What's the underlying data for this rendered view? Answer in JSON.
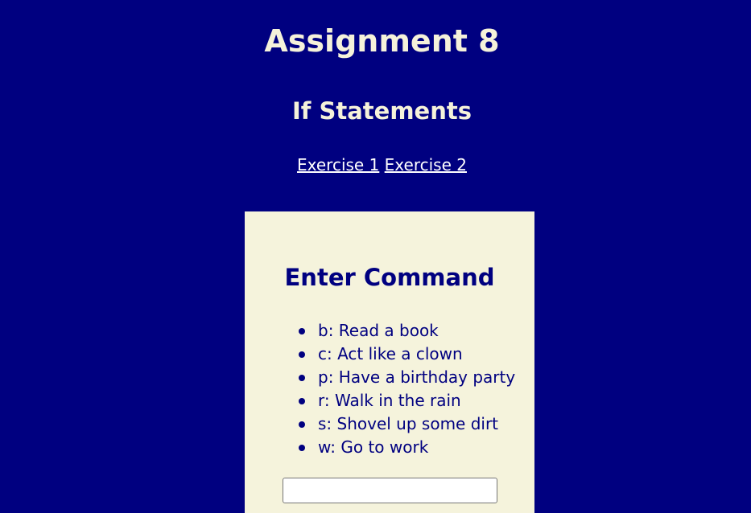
{
  "header": {
    "title": "Assignment 8",
    "subtitle": "If Statements",
    "links": [
      {
        "label": "Exercise 1"
      },
      {
        "label": "Exercise 2"
      }
    ]
  },
  "panel": {
    "title": "Enter Command",
    "commands": [
      {
        "label": "b: Read a book"
      },
      {
        "label": "c: Act like a clown"
      },
      {
        "label": "p: Have a birthday party"
      },
      {
        "label": "r: Walk in the rain"
      },
      {
        "label": "s: Shovel up some dirt"
      },
      {
        "label": "w: Go to work"
      }
    ],
    "input": {
      "value": "",
      "placeholder": ""
    }
  },
  "colors": {
    "background": "#000080",
    "panel_background": "#f5f3dc",
    "heading_text": "#f5f2da",
    "panel_text": "#000080"
  }
}
